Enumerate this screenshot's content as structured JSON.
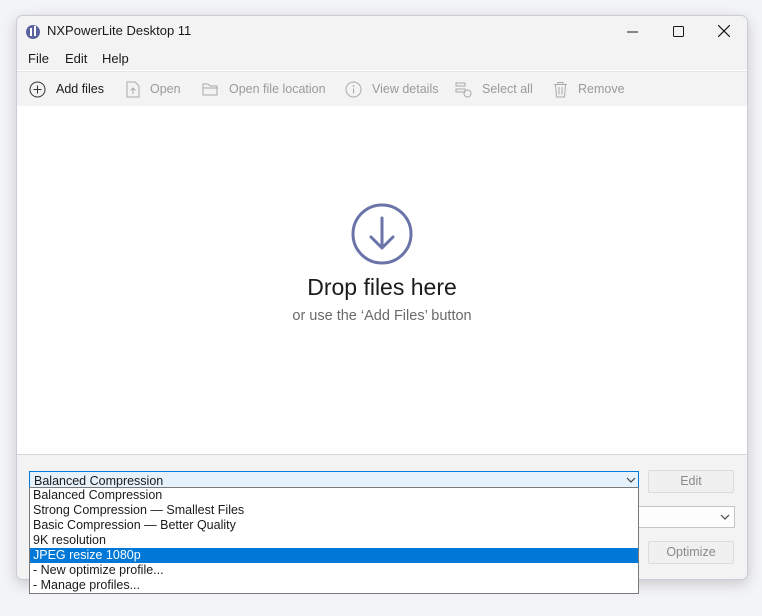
{
  "window": {
    "title": "NXPowerLite Desktop 11"
  },
  "menu": [
    "File",
    "Edit",
    "Help"
  ],
  "toolbar": {
    "add_files": "Add files",
    "open": "Open",
    "open_location": "Open file location",
    "view_details": "View details",
    "select_all": "Select all",
    "remove": "Remove"
  },
  "dropzone": {
    "title": "Drop files here",
    "subtitle": "or use the ‘Add Files’ button"
  },
  "profile": {
    "selected": "Balanced Compression",
    "options": [
      "Balanced Compression",
      "Strong Compression — Smallest Files",
      "Basic Compression — Better Quality",
      "9K resolution",
      "JPEG resize 1080p",
      "- New optimize profile...",
      "- Manage profiles..."
    ],
    "highlighted_index": 4
  },
  "buttons": {
    "edit": "Edit",
    "optimize": "Optimize"
  },
  "colors": {
    "accent": "#0078d7",
    "icon": "#6b74a8"
  }
}
